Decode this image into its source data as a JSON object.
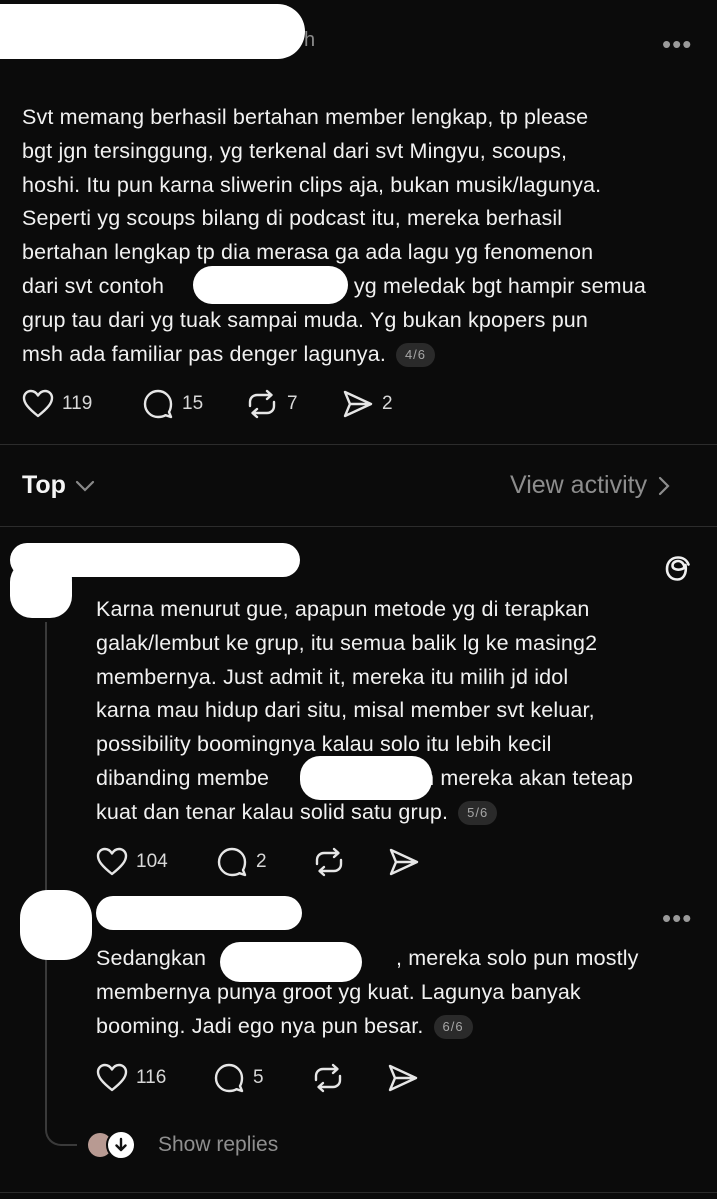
{
  "post": {
    "time_suffix": "h",
    "more": "•••",
    "lines": [
      "Svt memang berhasil bertahan member lengkap, tp please",
      "bgt jgn tersinggung, yg terkenal dari svt Mingyu, scoups,",
      "hoshi. Itu pun karna sliwerin clips aja, bukan musik/lagunya.",
      "Seperti yg scoups bilang di podcast itu, mereka berhasil",
      "bertahan lengkap tp dia merasa ga ada lagu yg fenomenon",
      "dari svt contoh                               yg meledak bgt hampir semua",
      "grup tau dari yg tuak sampai muda. Yg bukan kpopers pun",
      "msh ada familiar pas denger lagunya."
    ],
    "badge": "4/6",
    "likes": "119",
    "replies": "15",
    "reposts": "7",
    "shares": "2"
  },
  "section": {
    "sort_label": "Top",
    "view_activity": "View activity"
  },
  "reply1": {
    "lines": [
      "Karna menurut gue, apapun metode yg di terapkan",
      "galak/lembut ke grup, itu semua balik lg ke masing2",
      "membernya. Just admit it, mereka itu milih jd idol",
      "karna mau hidup dari situ, misal member svt keluar,",
      "possibility boomingnya kalau solo itu lebih kecil",
      "dibanding membe                       an mereka akan teteap",
      "kuat dan tenar kalau solid satu grup."
    ],
    "badge": "5/6",
    "likes": "104",
    "replies": "2"
  },
  "reply2": {
    "more": "•••",
    "lines": [
      "Sedangkan                               , mereka solo pun mostly",
      "membernya punya groot yg kuat. Lagunya banyak",
      "booming. Jadi ego nya pun besar."
    ],
    "badge": "6/6",
    "likes": "116",
    "replies": "5"
  },
  "footer": {
    "show_replies": "Show replies"
  },
  "icons": {
    "like": "heart-icon",
    "reply": "comment-icon",
    "repost": "repost-icon",
    "share": "send-icon",
    "threads": "threads-logo-icon",
    "chevron": "chevron-icon"
  }
}
